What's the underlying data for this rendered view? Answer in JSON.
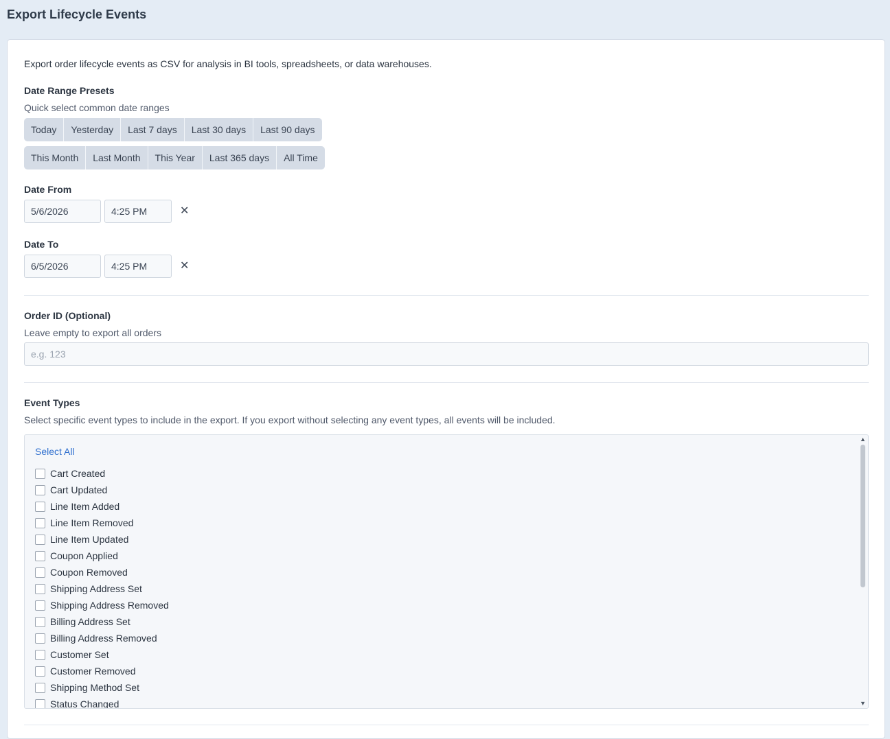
{
  "header": {
    "title": "Export Lifecycle Events"
  },
  "intro": "Export order lifecycle events as CSV for analysis in BI tools, spreadsheets, or data warehouses.",
  "presets": {
    "label": "Date Range Presets",
    "help": "Quick select common date ranges",
    "row1": [
      "Today",
      "Yesterday",
      "Last 7 days",
      "Last 30 days",
      "Last 90 days"
    ],
    "row2": [
      "This Month",
      "Last Month",
      "This Year",
      "Last 365 days",
      "All Time"
    ]
  },
  "date_from": {
    "label": "Date From",
    "date": "5/6/2026",
    "time": "4:25 PM",
    "clear": "✕"
  },
  "date_to": {
    "label": "Date To",
    "date": "6/5/2026",
    "time": "4:25 PM",
    "clear": "✕"
  },
  "order": {
    "label": "Order ID (Optional)",
    "help": "Leave empty to export all orders",
    "placeholder": "e.g. 123",
    "value": ""
  },
  "events": {
    "label": "Event Types",
    "help": "Select specific event types to include in the export. If you export without selecting any event types, all events will be included.",
    "select_all": "Select All",
    "items": [
      "Cart Created",
      "Cart Updated",
      "Line Item Added",
      "Line Item Removed",
      "Line Item Updated",
      "Coupon Applied",
      "Coupon Removed",
      "Shipping Address Set",
      "Shipping Address Removed",
      "Billing Address Set",
      "Billing Address Removed",
      "Customer Set",
      "Customer Removed",
      "Shipping Method Set",
      "Status Changed"
    ],
    "scroll_fraction": 0.0
  }
}
